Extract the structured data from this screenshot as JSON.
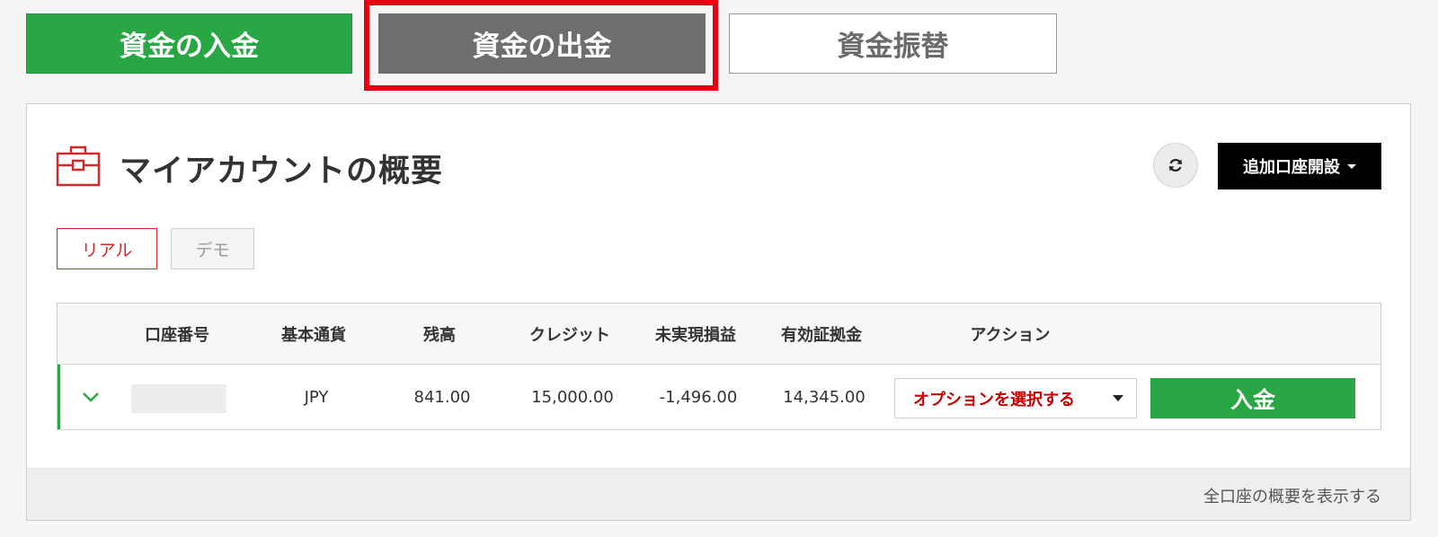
{
  "tabs": {
    "deposit": "資金の入金",
    "withdraw": "資金の出金",
    "transfer": "資金振替"
  },
  "panel": {
    "title": "マイアカウントの概要",
    "add_account_label": "追加口座開設",
    "segments": {
      "real": "リアル",
      "demo": "デモ"
    }
  },
  "table": {
    "headers": [
      "口座番号",
      "基本通貨",
      "残高",
      "クレジット",
      "未実現損益",
      "有効証拠金",
      "アクション"
    ],
    "rows": [
      {
        "currency": "JPY",
        "balance": "841.00",
        "credit": "15,000.00",
        "unrealized_pl": "-1,496.00",
        "equity": "14,345.00",
        "action_select": "オプションを選択する",
        "deposit_button": "入金"
      }
    ]
  },
  "footer": {
    "summary_link": "全口座の概要を表示する"
  },
  "colors": {
    "accent_green": "#2aa745",
    "accent_red": "#e60012",
    "brand_red": "#cc0000"
  },
  "icons": [
    "briefcase-icon",
    "refresh-icon",
    "chevron-down-icon",
    "caret-down-icon"
  ]
}
